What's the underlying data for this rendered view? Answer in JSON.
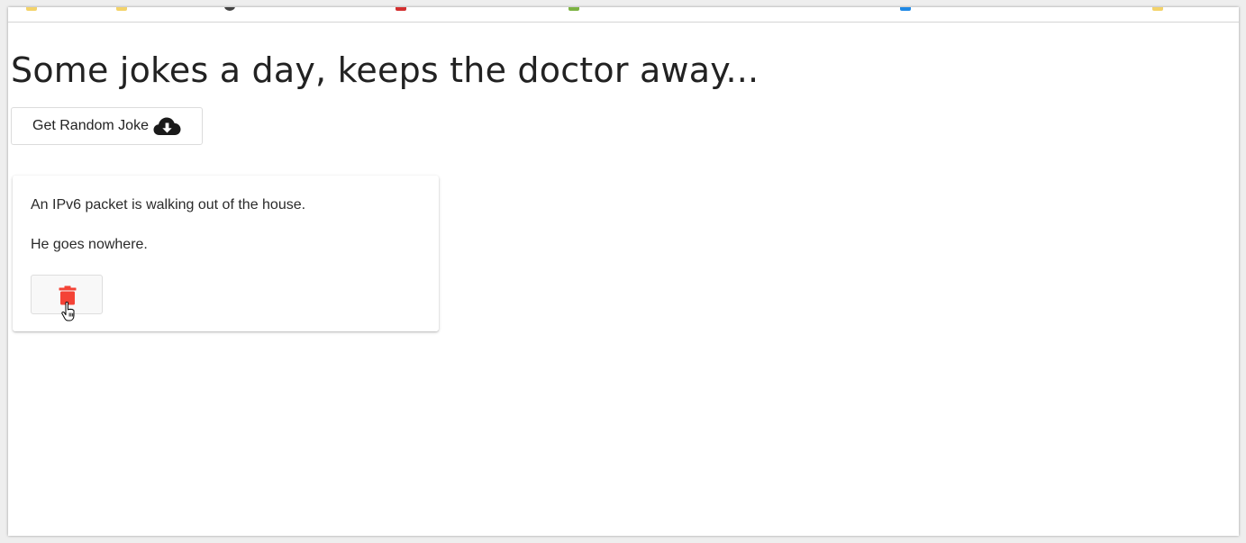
{
  "page": {
    "heading": "Some jokes a day, keeps the doctor away..."
  },
  "actions": {
    "random_joke_label": "Get Random Joke",
    "random_joke_icon": "cloud-download-icon"
  },
  "jokes": [
    {
      "setup": "An IPv6 packet is walking out of the house.",
      "delivery": "He goes nowhere.",
      "delete_icon": "trash-icon"
    }
  ],
  "colors": {
    "delete_icon": "#f44336",
    "text": "#222222",
    "background": "#ffffff"
  }
}
